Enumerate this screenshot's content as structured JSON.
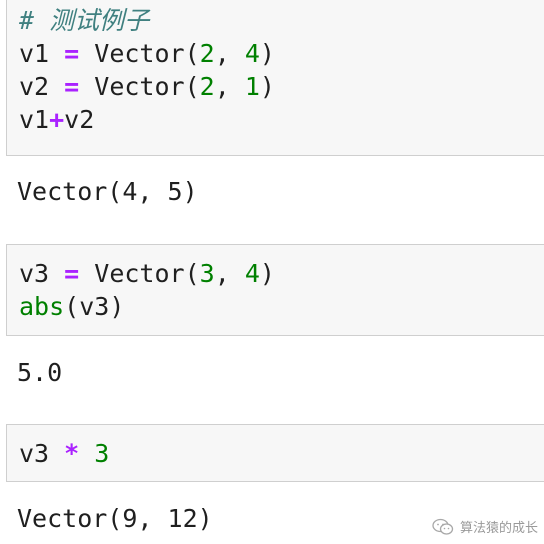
{
  "cells": [
    {
      "lines": [
        [
          {
            "t": "# 测试例子",
            "c": "cm"
          }
        ],
        [
          {
            "t": "v1 ",
            "c": "plain"
          },
          {
            "t": "=",
            "c": "op"
          },
          {
            "t": " Vector(",
            "c": "plain"
          },
          {
            "t": "2",
            "c": "num"
          },
          {
            "t": ", ",
            "c": "plain"
          },
          {
            "t": "4",
            "c": "num"
          },
          {
            "t": ")",
            "c": "plain"
          }
        ],
        [
          {
            "t": "v2 ",
            "c": "plain"
          },
          {
            "t": "=",
            "c": "op"
          },
          {
            "t": " Vector(",
            "c": "plain"
          },
          {
            "t": "2",
            "c": "num"
          },
          {
            "t": ", ",
            "c": "plain"
          },
          {
            "t": "1",
            "c": "num"
          },
          {
            "t": ")",
            "c": "plain"
          }
        ],
        [
          {
            "t": "v1",
            "c": "plain"
          },
          {
            "t": "+",
            "c": "op"
          },
          {
            "t": "v2",
            "c": "plain"
          }
        ]
      ],
      "output": "Vector(4, 5)"
    },
    {
      "lines": [
        [
          {
            "t": "v3 ",
            "c": "plain"
          },
          {
            "t": "=",
            "c": "op"
          },
          {
            "t": " Vector(",
            "c": "plain"
          },
          {
            "t": "3",
            "c": "num"
          },
          {
            "t": ", ",
            "c": "plain"
          },
          {
            "t": "4",
            "c": "num"
          },
          {
            "t": ")",
            "c": "plain"
          }
        ],
        [
          {
            "t": "abs",
            "c": "bi"
          },
          {
            "t": "(",
            "c": "plain"
          },
          {
            "t": "v3",
            "c": "plain"
          },
          {
            "t": ")",
            "c": "plain"
          }
        ]
      ],
      "output": "5.0"
    },
    {
      "lines": [
        [
          {
            "t": "v3 ",
            "c": "plain"
          },
          {
            "t": "*",
            "c": "op"
          },
          {
            "t": " ",
            "c": "plain"
          },
          {
            "t": "3",
            "c": "num"
          }
        ]
      ],
      "output": "Vector(9, 12)"
    }
  ],
  "watermark": {
    "text": "算法猿的成长",
    "icon": "wechat-icon"
  },
  "colors": {
    "comment": "#408080",
    "operator": "#aa22ff",
    "number": "#008000",
    "builtin": "#008000",
    "text": "#1f1f1f",
    "cell_bg": "#f7f7f7",
    "cell_border": "#cfcfcf"
  }
}
